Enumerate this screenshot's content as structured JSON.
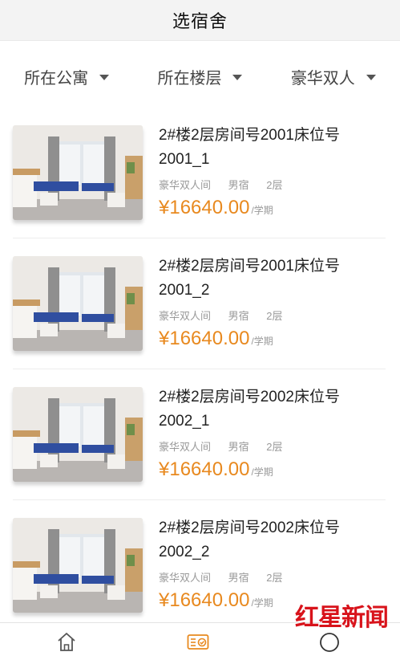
{
  "header": {
    "title": "选宿舍"
  },
  "filters": [
    {
      "label": "所在公寓"
    },
    {
      "label": "所在楼层"
    },
    {
      "label": "豪华双人"
    }
  ],
  "rooms": [
    {
      "name_line1": "2#楼2层房间号2001床位号",
      "name_line2": "2001_1",
      "type": "豪华双人间",
      "gender": "男宿",
      "floor": "2层",
      "price": "¥16640.00",
      "unit": "/学期"
    },
    {
      "name_line1": "2#楼2层房间号2001床位号",
      "name_line2": "2001_2",
      "type": "豪华双人间",
      "gender": "男宿",
      "floor": "2层",
      "price": "¥16640.00",
      "unit": "/学期"
    },
    {
      "name_line1": "2#楼2层房间号2002床位号",
      "name_line2": "2002_1",
      "type": "豪华双人间",
      "gender": "男宿",
      "floor": "2层",
      "price": "¥16640.00",
      "unit": "/学期"
    },
    {
      "name_line1": "2#楼2层房间号2002床位号",
      "name_line2": "2002_2",
      "type": "豪华双人间",
      "gender": "男宿",
      "floor": "2层",
      "price": "¥16640.00",
      "unit": "/学期"
    }
  ],
  "tabbar": {
    "tabs": [
      {
        "icon": "home-icon"
      },
      {
        "icon": "dorm-select-icon",
        "active": true
      },
      {
        "icon": "user-icon"
      }
    ]
  },
  "watermark": {
    "text": "红星新闻"
  },
  "colors": {
    "price": "#e8891f",
    "active_tab": "#e8891f",
    "watermark": "#d8131b"
  }
}
